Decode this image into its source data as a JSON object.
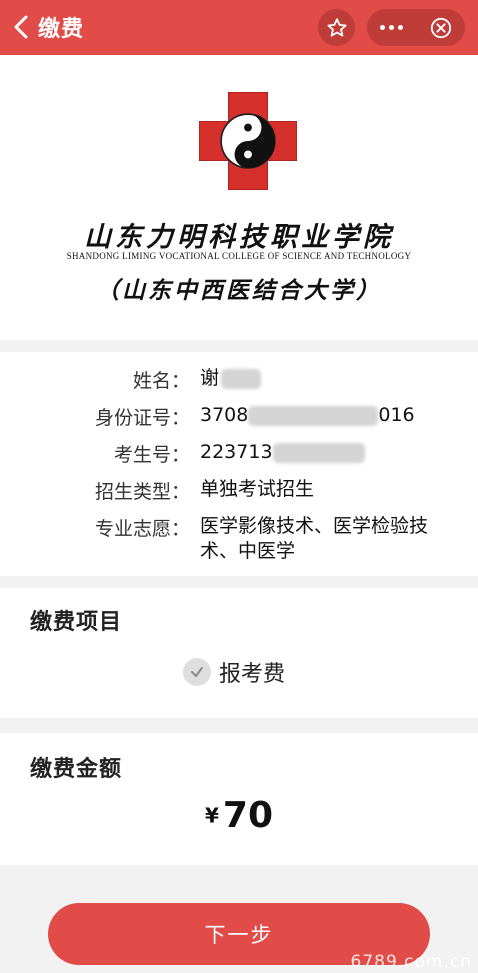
{
  "nav": {
    "title": "缴费",
    "bg_color": "#e14c48",
    "icons": [
      "chevron-left-icon",
      "star-icon",
      "more-dots-icon",
      "close-circle-icon"
    ]
  },
  "school": {
    "name_cn": "山东力明科技职业学院",
    "name_en": "SHANDONG LIMING VOCATIONAL COLLEGE OF SCIENCE AND TECHNOLOGY",
    "name_sub": "（山东中西医结合大学）"
  },
  "info": {
    "rows": [
      {
        "label": "姓名：",
        "value": "谢"
      },
      {
        "label": "身份证号：",
        "value_prefix": "3708",
        "value_suffix": "016"
      },
      {
        "label": "考生号：",
        "value": "223713"
      },
      {
        "label": "招生类型：",
        "value": "单独考试招生"
      },
      {
        "label": "专业志愿：",
        "value": "医学影像技术、医学检验技术、中医学"
      }
    ]
  },
  "fee_items": {
    "title": "缴费项目",
    "option": "报考费",
    "checked": true
  },
  "fee_amount": {
    "title": "缴费金额",
    "currency": "¥",
    "amount": "70"
  },
  "next_button": "下一步",
  "watermark": "6789.com.cn"
}
